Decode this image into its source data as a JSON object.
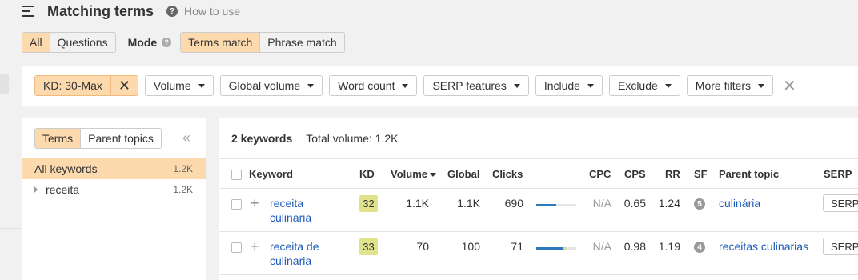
{
  "header": {
    "title": "Matching terms",
    "how_to": "How to use"
  },
  "scope_tabs": [
    {
      "label": "All",
      "active": true
    },
    {
      "label": "Questions",
      "active": false
    }
  ],
  "mode": {
    "label": "Mode",
    "options": [
      {
        "label": "Terms match",
        "active": true
      },
      {
        "label": "Phrase match",
        "active": false
      }
    ]
  },
  "filters": {
    "active_chip": "KD: 30-Max",
    "dropdowns": [
      "Volume",
      "Global volume",
      "Word count",
      "SERP features",
      "Include",
      "Exclude",
      "More filters"
    ]
  },
  "sidebar": {
    "tabs": [
      {
        "label": "Terms",
        "active": true
      },
      {
        "label": "Parent topics",
        "active": false
      }
    ],
    "items": [
      {
        "label": "All keywords",
        "value": "1.2K",
        "active": true
      },
      {
        "label": "receita",
        "value": "1.2K",
        "active": false
      }
    ]
  },
  "summary": {
    "keywords": "2 keywords",
    "total_volume": "Total volume: 1.2K"
  },
  "table": {
    "headers": {
      "keyword": "Keyword",
      "kd": "KD",
      "volume": "Volume",
      "global": "Global",
      "clicks": "Clicks",
      "cpc": "CPC",
      "cps": "CPS",
      "rr": "RR",
      "sf": "SF",
      "parent_topic": "Parent topic",
      "serp": "SERP"
    },
    "rows": [
      {
        "keyword_line1": "receita",
        "keyword_line2": "culinaria",
        "kd": "32",
        "volume": "1.1K",
        "global": "1.1K",
        "clicks": "690",
        "clicks_share": {
          "organic": 0.5,
          "paid": 0.0
        },
        "cpc": "N/A",
        "cps": "0.65",
        "rr": "1.24",
        "sf": "5",
        "parent_topic": "culinária",
        "serp_label": "SERP"
      },
      {
        "keyword_line1": "receita de",
        "keyword_line2": "culinaria",
        "kd": "33",
        "volume": "70",
        "global": "100",
        "clicks": "71",
        "clicks_share": {
          "organic": 0.68,
          "paid": 0.06
        },
        "cpc": "N/A",
        "cps": "0.98",
        "rr": "1.19",
        "sf": "4",
        "parent_topic": "receitas culinarias",
        "serp_label": "SERP"
      }
    ]
  },
  "colors": {
    "accent_fill": "#fdd9ae",
    "link": "#1e5bb8",
    "kd_badge": "#e0e38c",
    "bar_blue": "#2d7ac0"
  }
}
